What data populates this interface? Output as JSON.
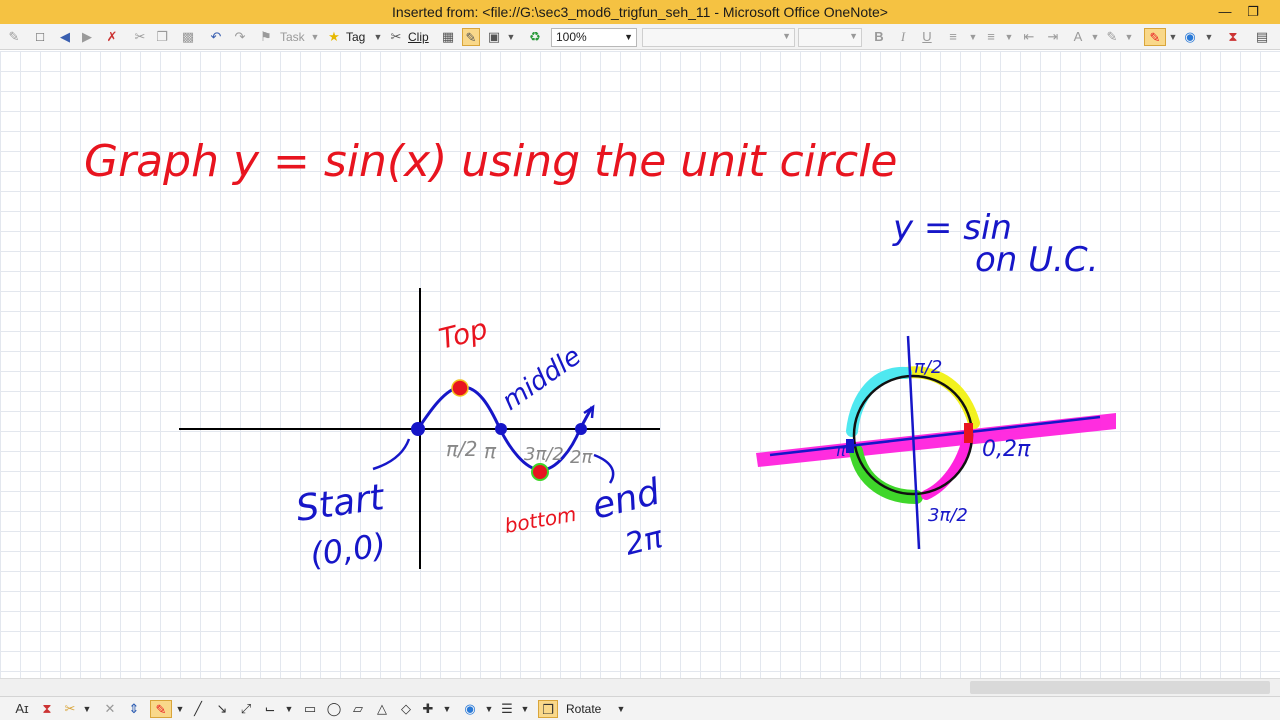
{
  "window": {
    "title": "Inserted from: <file://G:\\sec3_mod6_trigfun_seh_11 - Microsoft Office OneNote>"
  },
  "toolbar": {
    "task_label": "Task",
    "tag_label": "Tag",
    "clip_label": "Clip",
    "zoom": "100%",
    "bold": "B",
    "italic": "I",
    "underline": "U"
  },
  "drawing_toolbar": {
    "rotate_label": "Rotate"
  },
  "page": {
    "heading": "Graph  y = sin(x)  using  the  unit  circle",
    "note_line1": "y = sin",
    "note_line2": "on U.C.",
    "label_top": "Top",
    "label_middle": "middle",
    "label_bottom": "bottom",
    "label_start": "Start",
    "label_start_point": "(0,0)",
    "label_end": "end",
    "label_end_value": "2π",
    "tick_pi_over_2": "π/2",
    "tick_pi": "π",
    "tick_3pi_over_2": "3π/2",
    "tick_2pi": "2π",
    "circle_label_top": "π/2",
    "circle_label_right": "0,2π",
    "circle_label_left": "π",
    "circle_label_bottom": "3π/2"
  },
  "colors": {
    "title_bar": "#f5c242",
    "red_ink": "#e8141f",
    "blue_ink": "#1616c8",
    "magenta_highlight": "#ff22dd",
    "yellow_highlight": "#f2f21e",
    "cyan_highlight": "#4fe8f0",
    "green_highlight": "#3fd62a"
  }
}
